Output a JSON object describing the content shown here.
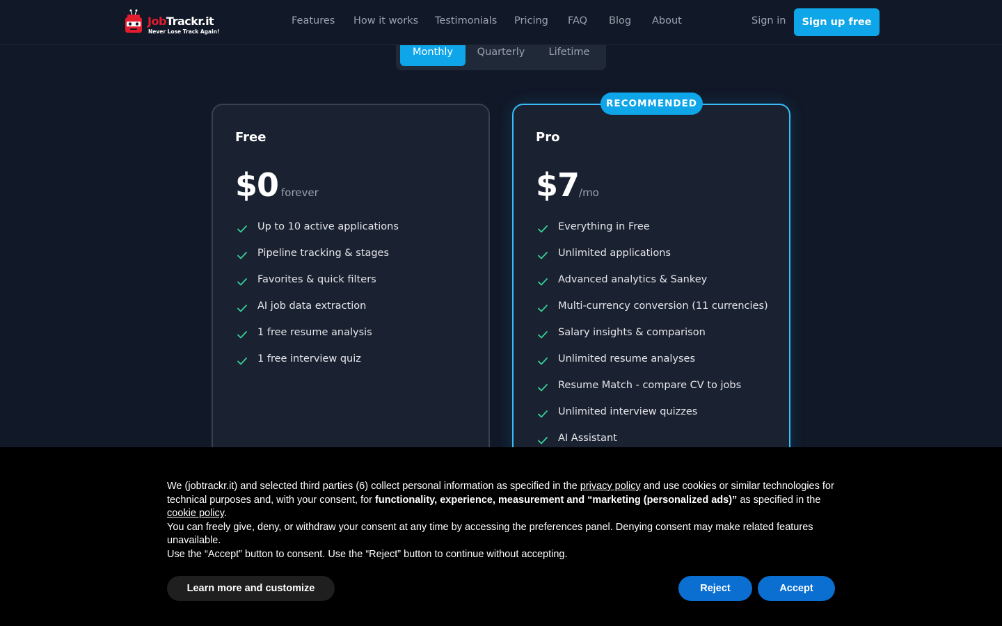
{
  "brand": {
    "name_part1": "Job",
    "name_part2": "Trackr.it",
    "tagline": "Never Lose Track Again!",
    "colors": {
      "red": "#e11d2e",
      "accent": "#0ea5e9"
    }
  },
  "nav": {
    "links": [
      "Features",
      "How it works",
      "Testimonials",
      "Pricing",
      "FAQ",
      "Blog",
      "About"
    ],
    "sign_in": "Sign in",
    "sign_up": "Sign up free"
  },
  "billing": {
    "options": [
      "Monthly",
      "Quarterly",
      "Lifetime"
    ],
    "selected": "Monthly"
  },
  "plans": [
    {
      "name": "Free",
      "price": "$0",
      "period": "forever",
      "features": [
        "Up to 10 active applications",
        "Pipeline tracking & stages",
        "Favorites & quick filters",
        "AI job data extraction",
        "1 free resume analysis",
        "1 free interview quiz"
      ]
    },
    {
      "name": "Pro",
      "badge": "RECOMMENDED",
      "price": "$7",
      "period": "/mo",
      "features": [
        "Everything in Free",
        "Unlimited applications",
        "Advanced analytics & Sankey",
        "Multi-currency conversion (11 currencies)",
        "Salary insights & comparison",
        "Unlimited resume analyses",
        "Resume Match - compare CV to jobs",
        "Unlimited interview quizzes",
        "AI Assistant"
      ]
    }
  ],
  "cookie": {
    "p1_a": "We (jobtrackr.it) and selected third parties (6) collect personal information as specified in the ",
    "p1_link1": "privacy policy",
    "p1_b": " and use cookies or similar technologies for technical purposes and, with your consent, for ",
    "p1_bold": "functionality, experience, measurement and “marketing (personalized ads)”",
    "p1_c": " as specified in the ",
    "p1_link2": "cookie policy",
    "p1_d": ".",
    "p2": "You can freely give, deny, or withdraw your consent at any time by accessing the preferences panel. Denying consent may make related features unavailable.",
    "p3": "Use the “Accept” button to consent. Use the “Reject” button to continue without accepting.",
    "learn_more": "Learn more and customize",
    "reject": "Reject",
    "accept": "Accept"
  }
}
